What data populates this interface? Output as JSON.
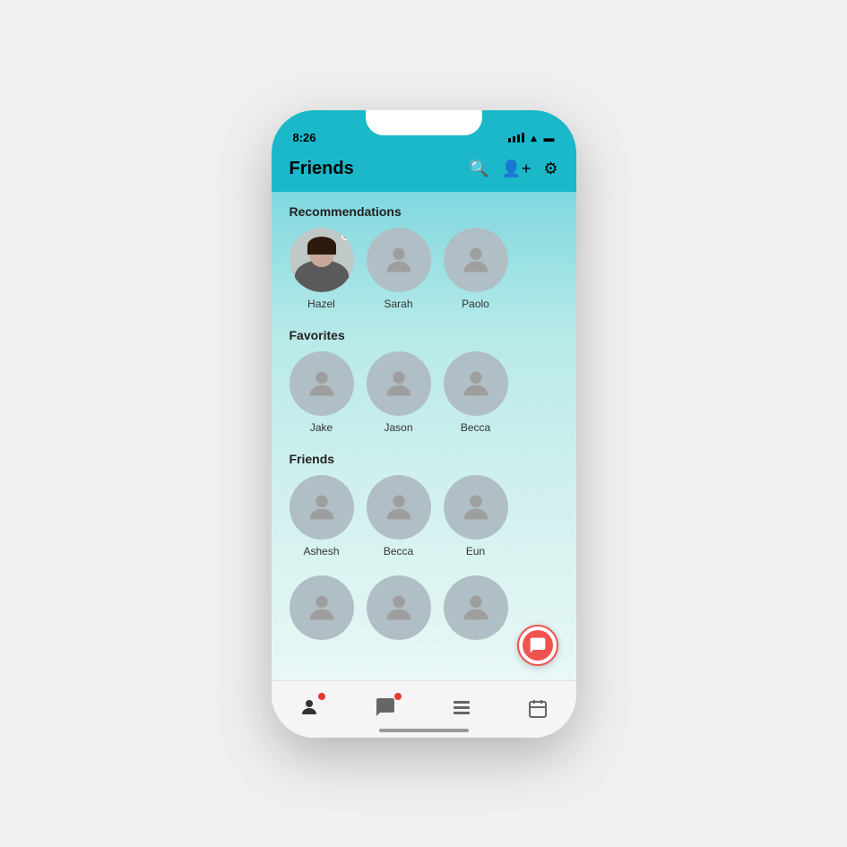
{
  "status_bar": {
    "time": "8:26"
  },
  "header": {
    "title": "Friends"
  },
  "sections": {
    "recommendations": {
      "label": "Recommendations",
      "people": [
        {
          "name": "Hazel",
          "has_photo": true,
          "has_dot": true
        },
        {
          "name": "Sarah",
          "has_photo": false,
          "has_dot": false
        },
        {
          "name": "Paolo",
          "has_photo": false,
          "has_dot": false
        }
      ]
    },
    "favorites": {
      "label": "Favorites",
      "people": [
        {
          "name": "Jake",
          "has_photo": false,
          "has_dot": false
        },
        {
          "name": "Jason",
          "has_photo": false,
          "has_dot": false
        },
        {
          "name": "Becca",
          "has_photo": false,
          "has_dot": false
        }
      ]
    },
    "friends": {
      "label": "Friends",
      "people": [
        {
          "name": "Ashesh",
          "has_photo": false,
          "has_dot": false
        },
        {
          "name": "Becca",
          "has_photo": false,
          "has_dot": false
        },
        {
          "name": "Eun",
          "has_photo": false,
          "has_dot": false
        }
      ]
    },
    "friends_more": {
      "people": [
        {
          "name": "",
          "has_photo": false
        },
        {
          "name": "",
          "has_photo": false
        },
        {
          "name": "",
          "has_photo": false
        }
      ]
    }
  },
  "nav": {
    "items": [
      {
        "icon": "person",
        "label": "Friends",
        "has_badge": true
      },
      {
        "icon": "chat",
        "label": "Messages",
        "has_badge": true
      },
      {
        "icon": "list",
        "label": "Feed",
        "has_badge": false
      },
      {
        "icon": "calendar",
        "label": "Events",
        "has_badge": false
      }
    ]
  },
  "fab": {
    "icon": "chat+"
  }
}
